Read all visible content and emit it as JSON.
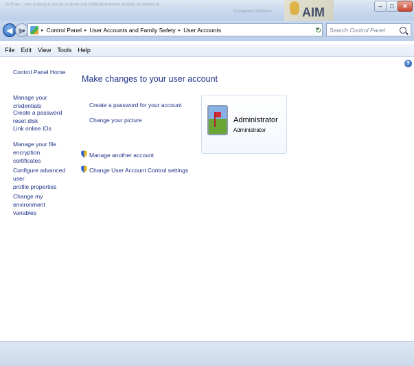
{
  "window": {
    "background_text": "Hi Evan, I was looking at my list of alerts and notification boxes actually no wishes to...",
    "background_text2": "Evangeline Windows",
    "background_logo_text": "AIM",
    "min_label": "–",
    "max_label": "□",
    "close_label": "✕"
  },
  "nav": {
    "back_glyph": "◀",
    "forward_glyph": "▶",
    "history_glyph": "▾"
  },
  "address": {
    "breadcrumbs": [
      "Control Panel",
      "User Accounts and Family Safety",
      "User Accounts"
    ],
    "separator": "▸",
    "dropdown_glyph": "▾",
    "refresh_glyph": "↻"
  },
  "search": {
    "placeholder": "Search Control Panel"
  },
  "menu": [
    "File",
    "Edit",
    "View",
    "Tools",
    "Help"
  ],
  "sidebar": {
    "home": "Control Panel Home",
    "items": [
      {
        "line1": "Manage your credentials",
        "line2": ""
      },
      {
        "line1": "Create a password reset disk",
        "line2": ""
      },
      {
        "line1": "Link online IDs",
        "line2": ""
      },
      {
        "line1": "Manage your file encryption",
        "line2": "certificates"
      },
      {
        "line1": "Configure advanced user",
        "line2": "profile properties"
      },
      {
        "line1": "Change my environment",
        "line2": "variables"
      }
    ]
  },
  "help_glyph": "?",
  "main": {
    "heading": "Make changes to your user account",
    "links": [
      "Create a password for your account",
      "Change your picture"
    ],
    "shield_links": [
      "Manage another account",
      "Change User Account Control settings"
    ]
  },
  "account": {
    "name": "Administrator",
    "type": "Administrator"
  }
}
